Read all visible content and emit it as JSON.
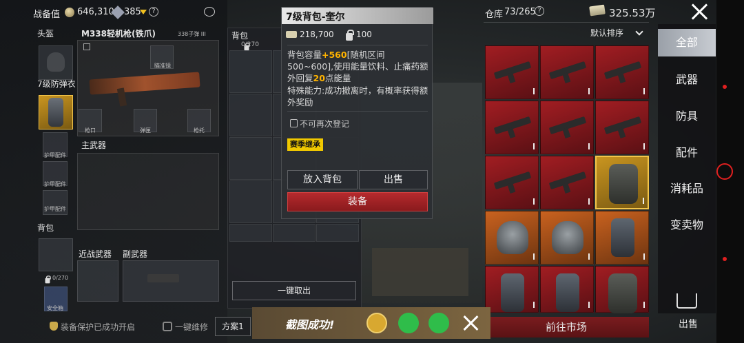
{
  "header": {
    "gear_value_label": "战备值",
    "gear_value": "646,310",
    "points": "385",
    "warehouse_label": "仓库",
    "warehouse_count": "73/265",
    "money": "325.53万"
  },
  "equip": {
    "helmet_label": "头盔",
    "weapon_name": "M338轻机枪(铁爪)",
    "ammo_text": "338子弹 III",
    "armor_label": "7级防弹衣",
    "scope_label": "瞄准镜",
    "muzzle_label": "枪口",
    "mag_label": "弹匣",
    "stock_label": "枪托",
    "armor_part_label": "护甲配件",
    "main_weapon_label": "主武器",
    "backpack_label": "背包",
    "melee_label": "近战武器",
    "secondary_label": "副武器",
    "pouch_label": "安全箱",
    "bag_capacity": "0/270",
    "protect_text": "装备保护已成功开启",
    "repair_text": "一键维修",
    "loadout_label": "方案1"
  },
  "backpack_panel": {
    "title": "背包",
    "capacity": "0/270",
    "take_all": "一键取出"
  },
  "tooltip": {
    "title": "7级背包-奎尔",
    "price": "218,700",
    "weight": "100",
    "desc_prefix": "背包容量",
    "desc_highlight": "+560",
    "desc_rest": "[随机区间500~600],使用能量饮料、止痛药额外回复",
    "desc_highlight2": "20",
    "desc_tail": "点能量",
    "ability": "特殊能力:成功撤离时，有概率获得额外奖励",
    "not_register": "不可再次登记",
    "season_tag": "赛季继承",
    "btn_put": "放入背包",
    "btn_sell": "出售",
    "btn_equip": "装备"
  },
  "warehouse": {
    "sort_label": "默认排序",
    "market_label": "前往市场"
  },
  "sidebar": {
    "items": [
      "全部",
      "武器",
      "防具",
      "配件",
      "消耗品",
      "变卖物"
    ],
    "sell_label": "出售"
  },
  "toast": {
    "text": "截图成功!"
  },
  "colors": {
    "accent_red": "#a11d22",
    "highlight_gold": "#f3c54a",
    "highlight_text": "#ffb300"
  }
}
